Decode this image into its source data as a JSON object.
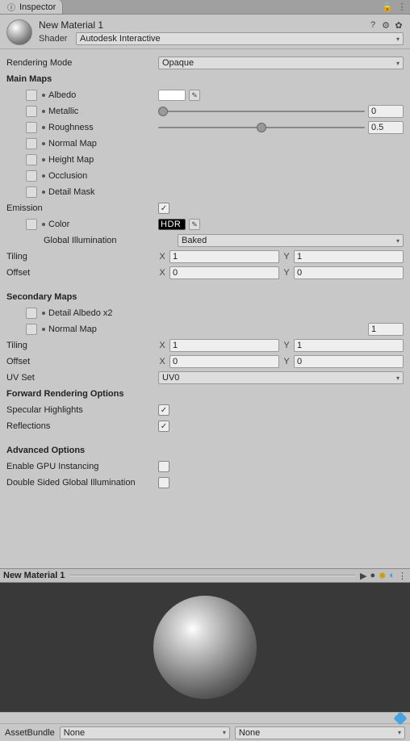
{
  "tab": {
    "title": "Inspector"
  },
  "header": {
    "title": "New Material 1",
    "shader_label": "Shader",
    "shader_value": "Autodesk Interactive"
  },
  "props": {
    "rendering_mode_label": "Rendering Mode",
    "rendering_mode_value": "Opaque",
    "main_maps_label": "Main Maps",
    "albedo_label": "Albedo",
    "metallic_label": "Metallic",
    "metallic_value": "0",
    "roughness_label": "Roughness",
    "roughness_value": "0.5",
    "normal_map_label": "Normal Map",
    "height_map_label": "Height Map",
    "occlusion_label": "Occlusion",
    "detail_mask_label": "Detail Mask",
    "emission_label": "Emission",
    "emission_on": true,
    "color_label": "Color",
    "hdr_badge": "HDR",
    "gi_label": "Global Illumination",
    "gi_value": "Baked",
    "tiling_label": "Tiling",
    "tiling_x": "1",
    "tiling_y": "1",
    "offset_label": "Offset",
    "offset_x": "0",
    "offset_y": "0",
    "secondary_maps_label": "Secondary Maps",
    "detail_albedo_label": "Detail Albedo x2",
    "normal_map2_label": "Normal Map",
    "normal_map2_value": "1",
    "tiling2_x": "1",
    "tiling2_y": "1",
    "offset2_x": "0",
    "offset2_y": "0",
    "uv_set_label": "UV Set",
    "uv_set_value": "UV0",
    "forward_label": "Forward Rendering Options",
    "specular_label": "Specular Highlights",
    "specular_on": true,
    "reflections_label": "Reflections",
    "reflections_on": true,
    "advanced_label": "Advanced Options",
    "gpu_instancing_label": "Enable GPU Instancing",
    "gpu_instancing_on": false,
    "double_sided_gi_label": "Double Sided Global Illumination",
    "double_sided_gi_on": false,
    "x_label": "X",
    "y_label": "Y"
  },
  "preview": {
    "title": "New Material 1"
  },
  "assetbundle": {
    "label": "AssetBundle",
    "value": "None",
    "variant": "None"
  }
}
